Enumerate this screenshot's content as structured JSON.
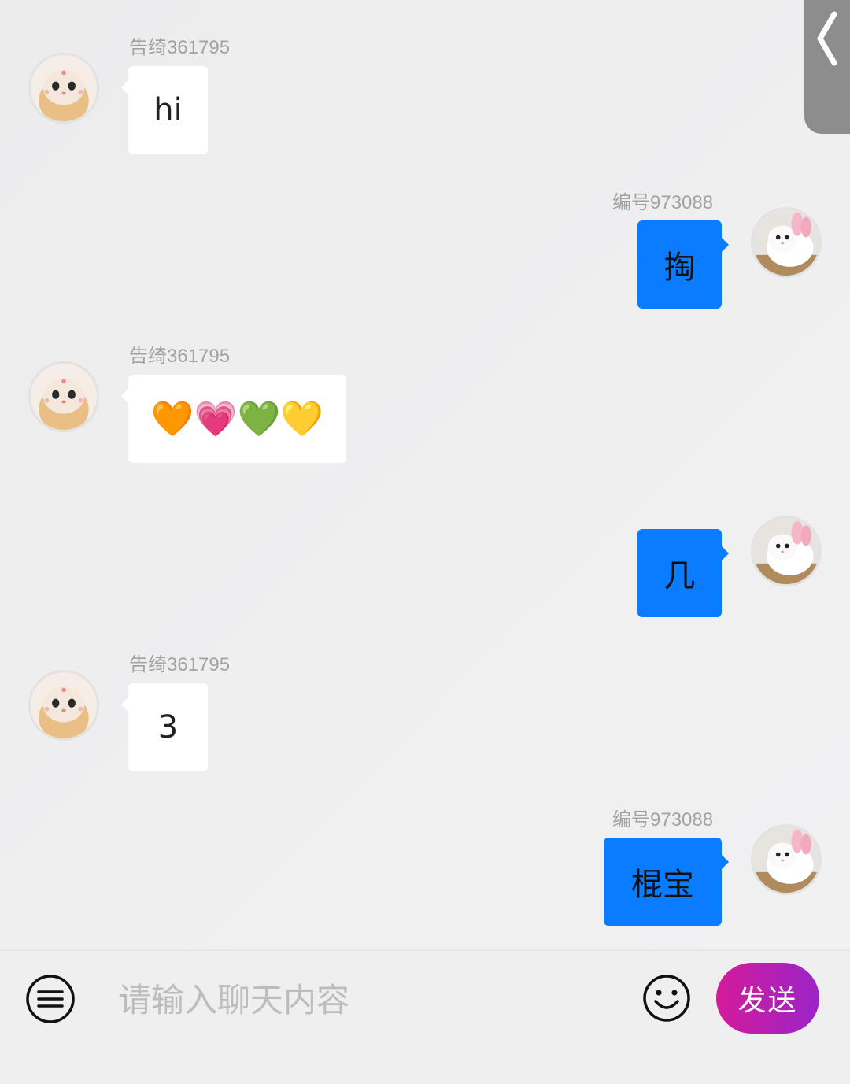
{
  "chat": {
    "messages": [
      {
        "direction": "in",
        "sender": "告绮361795",
        "text": "hi"
      },
      {
        "direction": "out",
        "sender": "编号973088",
        "text": "掏"
      },
      {
        "direction": "in",
        "sender": "告绮361795",
        "text": "🧡💗💚💛"
      },
      {
        "direction": "out",
        "sender": "",
        "text": "几"
      },
      {
        "direction": "in",
        "sender": "告绮361795",
        "text": "3"
      },
      {
        "direction": "out",
        "sender": "编号973088",
        "text": "棍宝"
      }
    ]
  },
  "composer": {
    "placeholder": "请输入聊天内容",
    "send_label": "发送"
  },
  "icons": {
    "back": "chevron-left-icon",
    "menu": "menu-icon",
    "emoji": "smiley-icon"
  },
  "colors": {
    "outgoing_bubble": "#0a7cff",
    "incoming_bubble": "#ffffff",
    "send_button_start": "#d41a9a",
    "send_button_end": "#9a25c9"
  }
}
